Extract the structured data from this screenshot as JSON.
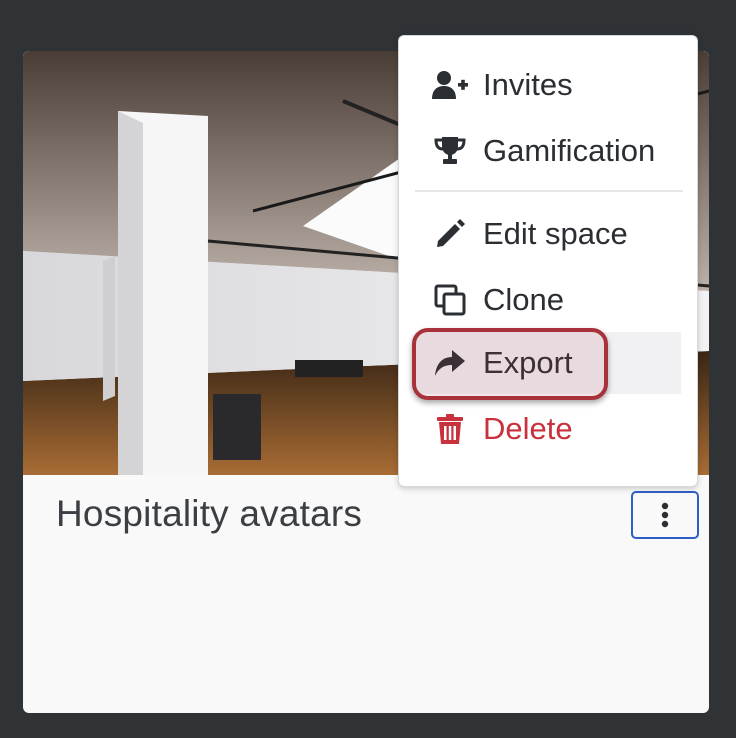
{
  "card": {
    "title": "Hospitality avatars",
    "thumbnail": "gallery-interior-image"
  },
  "kebab": {
    "icon": "vertical-ellipsis-icon"
  },
  "menu": {
    "items": [
      {
        "label": "Invites",
        "icon": "user-plus-icon"
      },
      {
        "label": "Gamification",
        "icon": "trophy-icon"
      },
      {
        "label": "Edit space",
        "icon": "pencil-icon"
      },
      {
        "label": "Clone",
        "icon": "clone-icon"
      },
      {
        "label": "Export",
        "icon": "share-arrow-icon",
        "highlighted": true
      },
      {
        "label": "Delete",
        "icon": "trash-icon",
        "danger": true
      }
    ]
  },
  "colors": {
    "background": "#2f3336",
    "card": "#f9f9f9",
    "focus_ring": "#2f5fc4",
    "danger": "#c8323c",
    "highlight_ring": "#a8323b"
  }
}
